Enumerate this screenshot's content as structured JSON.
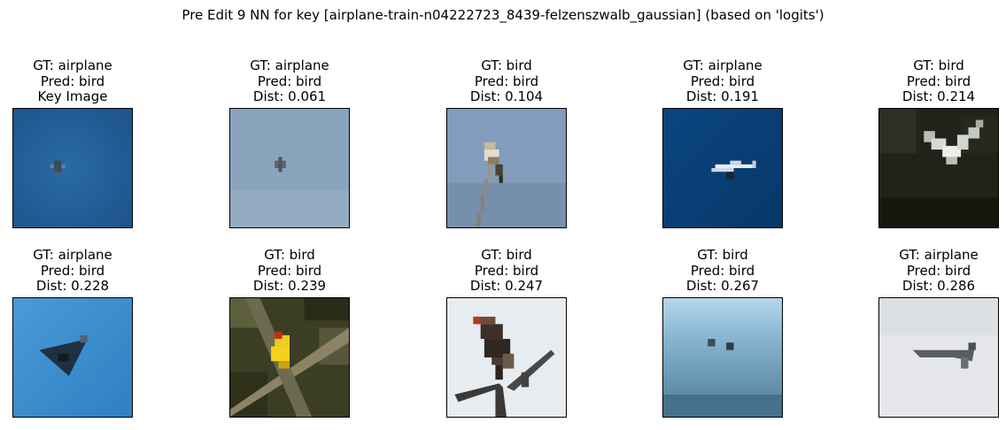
{
  "figure": {
    "title": "Pre Edit 9 NN for key [airplane-train-n04222723_8439-felzenszwalb_gaussian] (based on 'logits')"
  },
  "panels": [
    {
      "gt": "GT: airplane",
      "pred": "Pred: bird",
      "extra": "Key Image",
      "image": "small-aircraft-blue-sky",
      "bg": "#235d97"
    },
    {
      "gt": "GT: airplane",
      "pred": "Pred: bird",
      "extra": "Dist: 0.061",
      "image": "distant-aircraft-grey-sky",
      "bg": "#8aa4bd"
    },
    {
      "gt": "GT: bird",
      "pred": "Pred: bird",
      "extra": "Dist: 0.104",
      "image": "bird-perched-on-stick",
      "bg": "#7f9bbb"
    },
    {
      "gt": "GT: airplane",
      "pred": "Pred: bird",
      "extra": "Dist: 0.191",
      "image": "white-jet-deep-blue-sky",
      "bg": "#0c4b85"
    },
    {
      "gt": "GT: bird",
      "pred": "Pred: bird",
      "extra": "Dist: 0.214",
      "image": "white-egret-dark-forest",
      "bg": "#1e2218"
    },
    {
      "gt": "GT: airplane",
      "pred": "Pred: bird",
      "extra": "Dist: 0.228",
      "image": "delta-wing-jet-blue-sky",
      "bg": "#3d8fd0"
    },
    {
      "gt": "GT: bird",
      "pred": "Pred: bird",
      "extra": "Dist: 0.239",
      "image": "yellow-bird-in-branches",
      "bg": "#3b3d24"
    },
    {
      "gt": "GT: bird",
      "pred": "Pred: bird",
      "extra": "Dist: 0.247",
      "image": "hawk-on-branch",
      "bg": "#e6ebf0"
    },
    {
      "gt": "GT: bird",
      "pred": "Pred: bird",
      "extra": "Dist: 0.267",
      "image": "two-birds-over-water",
      "bg": "#7aa8c2"
    },
    {
      "gt": "GT: airplane",
      "pred": "Pred: bird",
      "extra": "Dist: 0.286",
      "image": "aircraft-overcast-sky",
      "bg": "#e4e6ea"
    }
  ]
}
